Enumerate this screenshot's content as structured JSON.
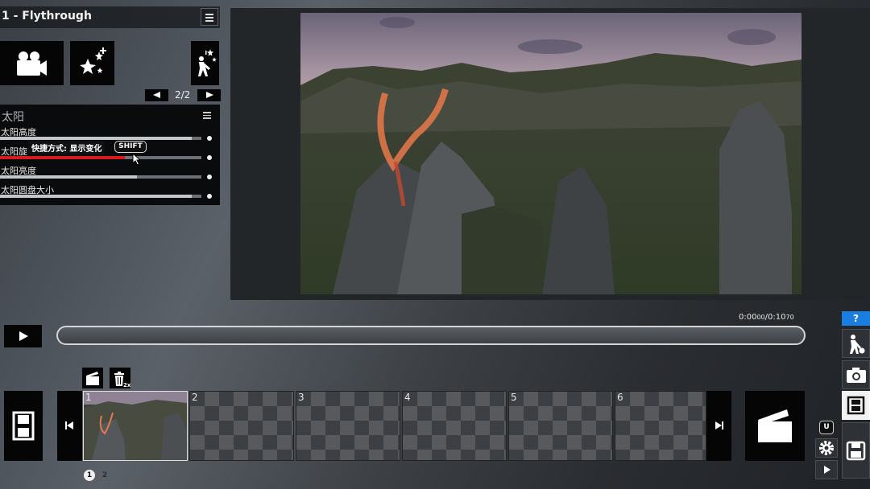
{
  "window": {
    "title": "1 - Flythrough"
  },
  "modes": {
    "pager": "2/2",
    "items": [
      {
        "icon": "movie-camera-icon"
      },
      {
        "icon": "sparkles-icon"
      },
      {
        "icon": "sparkle-figure-icon"
      }
    ]
  },
  "panel": {
    "title": "太阳",
    "properties": [
      {
        "label": "太阳高度",
        "level": 0.95
      },
      {
        "label": "太阳旋",
        "level": 0.62
      },
      {
        "label": "太阳亮度",
        "level": 0.68
      },
      {
        "label": "太阳圆盘大小",
        "level": 0.95
      }
    ],
    "tooltip": "快捷方式: 显示变化",
    "tooltip_key": "SHIFT",
    "highlight_color": "#d81a1a"
  },
  "timeline": {
    "timecode": "0:00",
    "timecode_small": "00",
    "timecode_end": "/0:10",
    "timecode_end_small": "70",
    "progress": 0
  },
  "toolbar": {
    "delete_badge": "2x"
  },
  "filmstrip": {
    "frames": [
      {
        "number": "1",
        "filled": true
      },
      {
        "number": "2",
        "filled": false
      },
      {
        "number": "3",
        "filled": false
      },
      {
        "number": "4",
        "filled": false
      },
      {
        "number": "5",
        "filled": false
      },
      {
        "number": "6",
        "filled": false
      }
    ]
  },
  "pagination": {
    "pages": [
      "1",
      "2"
    ],
    "current": "1"
  },
  "sidebar": {
    "help_label": "?",
    "shortcut_key": "U",
    "accent": "#1a7ee0"
  }
}
